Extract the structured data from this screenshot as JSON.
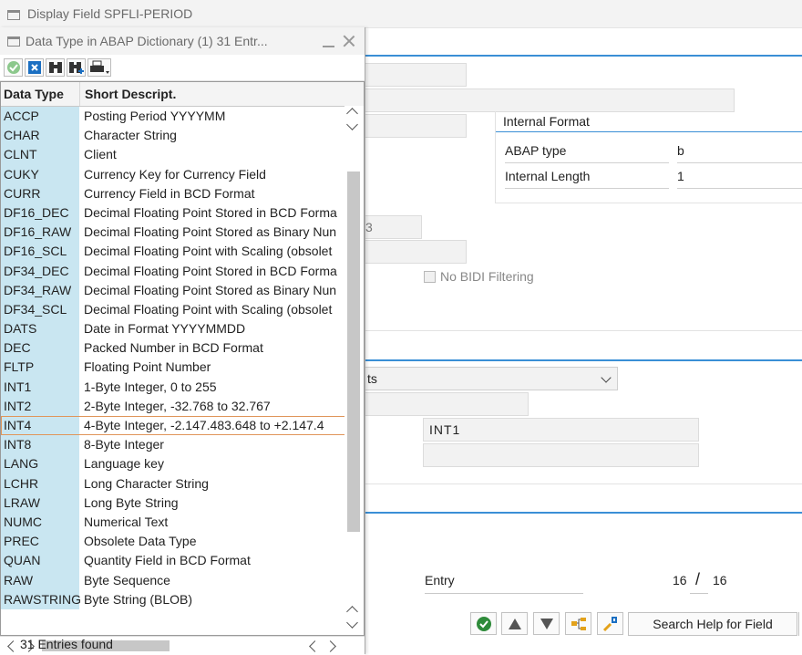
{
  "main_window": {
    "title": "Display Field SPFLI-PERIOD",
    "internal_format": {
      "header": "Internal Format",
      "abap_type_label": "ABAP type",
      "abap_type_value": "b",
      "internal_length_label": "Internal Length",
      "internal_length_value": "1"
    },
    "partial_field_value": "3",
    "no_bidi_label": "No BIDI Filtering",
    "dropdown_partial_text": "ts",
    "domain_value": "INT1",
    "entry_label": "Entry",
    "entry_current": "16",
    "entry_separator": "/",
    "entry_total": "16",
    "search_help_button": "Search Help for Field"
  },
  "popup": {
    "title": "Data Type in ABAP Dictionary (1)   31 Entr...",
    "columns": {
      "type": "Data Type",
      "desc": "Short Descript."
    },
    "rows": [
      {
        "type": "ACCP",
        "desc": "Posting Period YYYYMM"
      },
      {
        "type": "CHAR",
        "desc": "Character String"
      },
      {
        "type": "CLNT",
        "desc": "Client"
      },
      {
        "type": "CUKY",
        "desc": "Currency Key for Currency Field"
      },
      {
        "type": "CURR",
        "desc": "Currency Field in BCD Format"
      },
      {
        "type": "DF16_DEC",
        "desc": "Decimal Floating Point Stored in BCD Forma"
      },
      {
        "type": "DF16_RAW",
        "desc": "Decimal Floating Point Stored as Binary Nun"
      },
      {
        "type": "DF16_SCL",
        "desc": "Decimal Floating Point with Scaling (obsolet"
      },
      {
        "type": "DF34_DEC",
        "desc": "Decimal Floating Point Stored in BCD Forma"
      },
      {
        "type": "DF34_RAW",
        "desc": "Decimal Floating Point Stored as Binary Nun"
      },
      {
        "type": "DF34_SCL",
        "desc": "Decimal Floating Point with Scaling (obsolet"
      },
      {
        "type": "DATS",
        "desc": "Date in Format YYYYMMDD"
      },
      {
        "type": "DEC",
        "desc": "Packed Number in BCD Format"
      },
      {
        "type": "FLTP",
        "desc": "Floating Point Number"
      },
      {
        "type": "INT1",
        "desc": "1-Byte Integer, 0 to 255"
      },
      {
        "type": "INT2",
        "desc": "2-Byte Integer, -32.768 to 32.767"
      },
      {
        "type": "INT4",
        "desc": "4-Byte Integer, -2.147.483.648 to +2.147.4"
      },
      {
        "type": "INT8",
        "desc": "8-Byte Integer"
      },
      {
        "type": "LANG",
        "desc": "Language key"
      },
      {
        "type": "LCHR",
        "desc": "Long Character String"
      },
      {
        "type": "LRAW",
        "desc": "Long Byte String"
      },
      {
        "type": "NUMC",
        "desc": "Numerical Text"
      },
      {
        "type": "PREC",
        "desc": "Obsolete Data Type"
      },
      {
        "type": "QUAN",
        "desc": "Quantity Field in BCD Format"
      },
      {
        "type": "RAW",
        "desc": "Byte Sequence"
      },
      {
        "type": "RAWSTRING",
        "desc": "Byte String (BLOB)"
      }
    ],
    "selected_type": "INT4",
    "status": "31 Entries found"
  },
  "colors": {
    "accent_blue": "#3a8fd6",
    "type_column_bg": "#c9e6f1",
    "selection_outline": "#e0955a",
    "confirm_green": "#2e8b3a",
    "close_blue": "#1b6fc2"
  }
}
